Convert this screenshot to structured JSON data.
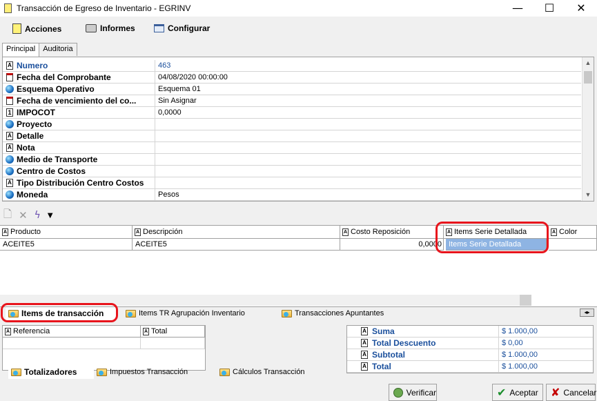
{
  "window": {
    "title": "Transacción de Egreso de Inventario - EGRINV"
  },
  "menu": {
    "items": [
      {
        "label": "Acciones",
        "icon": "document-icon"
      },
      {
        "label": "Informes",
        "icon": "printer-icon"
      },
      {
        "label": "Configurar",
        "icon": "settings-window-icon"
      }
    ]
  },
  "top_tabs": [
    "Principal",
    "Auditoria"
  ],
  "properties": [
    {
      "name": "Numero",
      "value": "463",
      "icon": "text-field-icon"
    },
    {
      "name": "Fecha del Comprobante",
      "value": "04/08/2020 00:00:00",
      "icon": "calendar-icon"
    },
    {
      "name": "Esquema Operativo",
      "value": "Esquema 01",
      "icon": "globe-icon"
    },
    {
      "name": "Fecha de vencimiento del co...",
      "value": "Sin Asignar",
      "icon": "calendar-icon"
    },
    {
      "name": "IMPOCOT",
      "value": "0,0000",
      "icon": "number-field-icon"
    },
    {
      "name": "Proyecto",
      "value": "",
      "icon": "globe-icon"
    },
    {
      "name": "Detalle",
      "value": "",
      "icon": "text-field-icon"
    },
    {
      "name": "Nota",
      "value": "",
      "icon": "text-field-icon"
    },
    {
      "name": "Medio de Transporte",
      "value": "",
      "icon": "globe-icon"
    },
    {
      "name": "Centro de Costos",
      "value": "",
      "icon": "globe-icon"
    },
    {
      "name": "Tipo Distribución Centro Costos",
      "value": "",
      "icon": "text-field-icon"
    },
    {
      "name": "Moneda",
      "value": "Pesos",
      "icon": "globe-icon"
    }
  ],
  "detail_grid": {
    "columns": [
      "Producto",
      "Descripción",
      "Costo Reposición",
      "Items Serie Detallada",
      "Color"
    ],
    "rows": [
      {
        "producto": "ACEITE5",
        "descripcion": "ACEITE5",
        "costo": "0,0000",
        "items_serie": "Items Serie Detallada",
        "color": ""
      }
    ]
  },
  "bottom_tabs": [
    "Items de transacción",
    "Items TR Agrupación Inventario",
    "Transacciones Apuntantes"
  ],
  "reference_grid": {
    "columns": [
      "Referencia",
      "Total"
    ]
  },
  "totals": [
    {
      "name": "Suma",
      "value": "$ 1.000,00"
    },
    {
      "name": "Total Descuento",
      "value": "$ 0,00"
    },
    {
      "name": "Subtotal",
      "value": "$ 1.000,00"
    },
    {
      "name": "Total",
      "value": "$ 1.000,00"
    }
  ],
  "lower_tabs": [
    "Totalizadores",
    "Impuestos Transacción",
    "Cálculos Transacción"
  ],
  "footer": {
    "verificar": "Verificar",
    "aceptar": "Aceptar",
    "cancelar": "Cancelar"
  }
}
